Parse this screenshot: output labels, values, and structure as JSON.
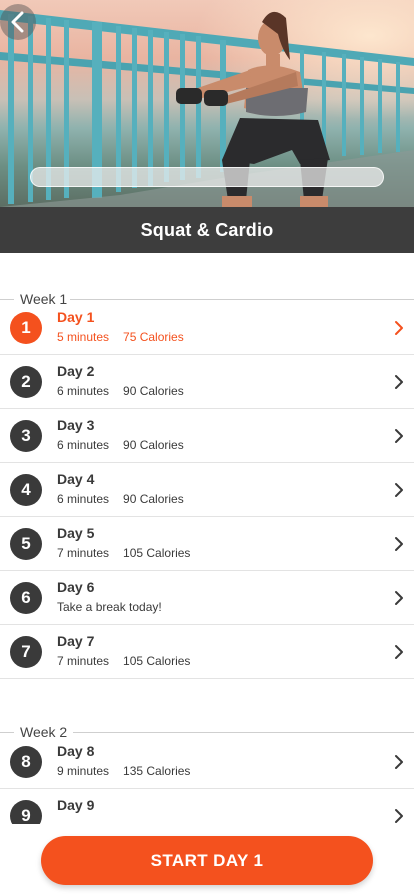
{
  "workout": {
    "title": "Squat & Cardio"
  },
  "icons": {
    "back": "chevron-left-icon",
    "row_arrow": "chevron-right-icon"
  },
  "colors": {
    "accent": "#f4511e",
    "dark": "#3a3a3a",
    "title_bar": "#3d3d3d"
  },
  "weeks": [
    {
      "label": "Week 1",
      "days": [
        {
          "number": "1",
          "name": "Day 1",
          "duration": "5 minutes",
          "calories": "75 Calories",
          "active": true
        },
        {
          "number": "2",
          "name": "Day 2",
          "duration": "6 minutes",
          "calories": "90 Calories"
        },
        {
          "number": "3",
          "name": "Day 3",
          "duration": "6 minutes",
          "calories": "90 Calories"
        },
        {
          "number": "4",
          "name": "Day 4",
          "duration": "6 minutes",
          "calories": "90 Calories"
        },
        {
          "number": "5",
          "name": "Day 5",
          "duration": "7 minutes",
          "calories": "105 Calories"
        },
        {
          "number": "6",
          "name": "Day 6",
          "note": "Take a break today!"
        },
        {
          "number": "7",
          "name": "Day 7",
          "duration": "7 minutes",
          "calories": "105 Calories"
        }
      ]
    },
    {
      "label": "Week 2",
      "days": [
        {
          "number": "8",
          "name": "Day 8",
          "duration": "9 minutes",
          "calories": "135 Calories"
        },
        {
          "number": "9",
          "name": "Day 9",
          "duration": "",
          "calories": ""
        }
      ]
    }
  ],
  "actions": {
    "start_label": "START DAY 1"
  }
}
